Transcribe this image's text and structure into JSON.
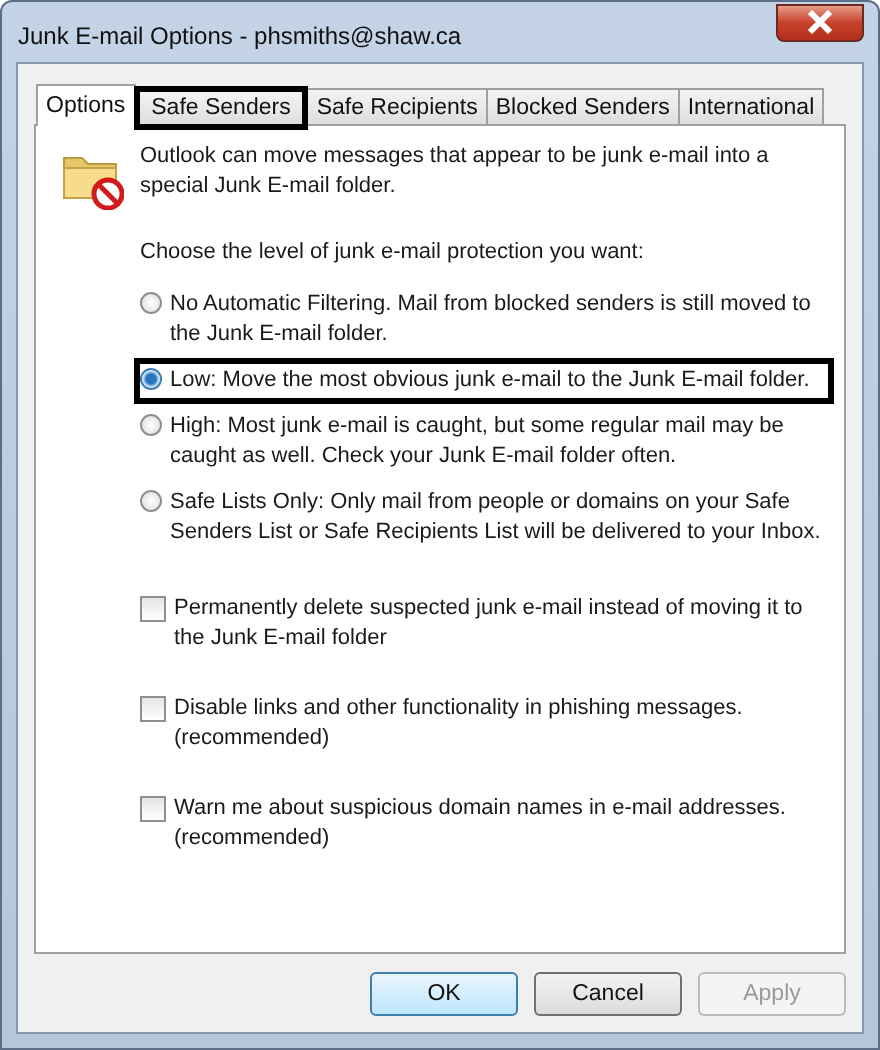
{
  "window": {
    "title": "Junk E-mail Options - phsmiths@shaw.ca"
  },
  "tabs": [
    {
      "label": "Options",
      "selected": true,
      "highlighted": false
    },
    {
      "label": "Safe Senders",
      "selected": false,
      "highlighted": true
    },
    {
      "label": "Safe Recipients",
      "selected": false,
      "highlighted": false
    },
    {
      "label": "Blocked Senders",
      "selected": false,
      "highlighted": false
    },
    {
      "label": "International",
      "selected": false,
      "highlighted": false
    }
  ],
  "intro": "Outlook can move messages that appear to be junk e-mail into a special Junk E-mail folder.",
  "prompt": "Choose the level of junk e-mail protection you want:",
  "levels": [
    {
      "label": "No Automatic Filtering. Mail from blocked senders is still moved to the Junk E-mail folder.",
      "selected": false,
      "highlighted": false
    },
    {
      "label": "Low: Move the most obvious junk e-mail to the Junk E-mail folder.",
      "selected": true,
      "highlighted": true
    },
    {
      "label": "High: Most junk e-mail is caught, but some regular mail may be caught as well. Check your Junk E-mail folder often.",
      "selected": false,
      "highlighted": false
    },
    {
      "label": "Safe Lists Only: Only mail from people or domains on your Safe Senders List or Safe Recipients List will be delivered to your Inbox.",
      "selected": false,
      "highlighted": false
    }
  ],
  "options": [
    {
      "label": "Permanently delete suspected junk e-mail instead of moving it to the Junk E-mail folder",
      "checked": false
    },
    {
      "label": "Disable links and other functionality in phishing messages. (recommended)",
      "checked": false
    },
    {
      "label": "Warn me about suspicious domain names in e-mail addresses. (recommended)",
      "checked": false
    }
  ],
  "buttons": [
    {
      "label": "OK",
      "kind": "default",
      "disabled": false
    },
    {
      "label": "Cancel",
      "kind": "normal",
      "disabled": false
    },
    {
      "label": "Apply",
      "kind": "normal",
      "disabled": true
    }
  ]
}
